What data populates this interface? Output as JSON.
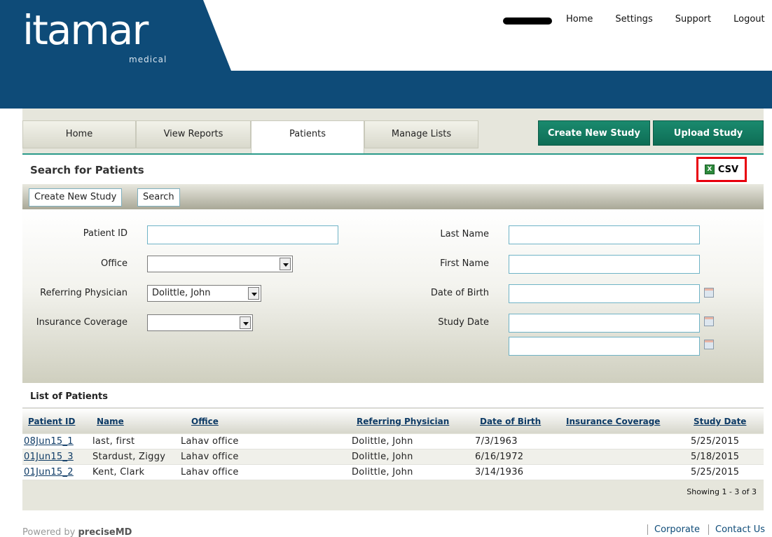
{
  "brand": {
    "name": "itamar",
    "tagline": "medical"
  },
  "topnav": [
    "Home",
    "Settings",
    "Support",
    "Logout"
  ],
  "tabs": [
    {
      "label": "Home",
      "active": false
    },
    {
      "label": "View Reports",
      "active": false
    },
    {
      "label": "Patients",
      "active": true
    },
    {
      "label": "Manage Lists",
      "active": false
    }
  ],
  "actions": {
    "create_new_study": "Create New Study",
    "upload_study": "Upload Study"
  },
  "search": {
    "title": "Search for Patients",
    "csv_label": "CSV",
    "toolbar": {
      "create_new_study": "Create New Study",
      "search": "Search"
    },
    "fields": {
      "patient_id": {
        "label": "Patient ID",
        "value": ""
      },
      "office": {
        "label": "Office",
        "value": ""
      },
      "referring_physician": {
        "label": "Referring Physician",
        "value": "Dolittle, John"
      },
      "insurance_coverage": {
        "label": "Insurance Coverage",
        "value": ""
      },
      "last_name": {
        "label": "Last Name",
        "value": ""
      },
      "first_name": {
        "label": "First Name",
        "value": ""
      },
      "date_of_birth": {
        "label": "Date of Birth",
        "value": ""
      },
      "study_date": {
        "label": "Study Date",
        "from": "",
        "to": ""
      }
    }
  },
  "list": {
    "title": "List of Patients",
    "columns": [
      "Patient ID",
      "Name",
      "Office",
      "Referring Physician",
      "Date of Birth",
      "Insurance Coverage",
      "Study Date"
    ],
    "rows": [
      [
        "08Jun15_1",
        "last, first",
        "Lahav office",
        "Dolittle, John",
        "7/3/1963",
        "",
        "5/25/2015"
      ],
      [
        "01Jun15_3",
        "Stardust, Ziggy",
        "Lahav office",
        "Dolittle, John",
        "6/16/1972",
        "",
        "5/18/2015"
      ],
      [
        "01Jun15_2",
        "Kent, Clark",
        "Lahav office",
        "Dolittle, John",
        "3/14/1936",
        "",
        "5/25/2015"
      ]
    ],
    "showing": "Showing 1 - 3 of 3"
  },
  "footer": {
    "powered_by": "Powered by",
    "brand": "preciseMD",
    "links": [
      "Corporate",
      "Contact Us"
    ]
  },
  "colors": {
    "header_blue": "#0e4b78",
    "action_green": "#0e6d55",
    "highlight_red": "#e8000c"
  }
}
